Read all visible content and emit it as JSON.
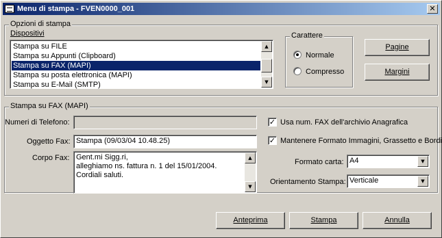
{
  "window": {
    "title": "Menu di stampa - FVEN0000_001",
    "close_glyph": "✕"
  },
  "options": {
    "title": "Opzioni di stampa",
    "devices_label": "Dispositivi",
    "devices": [
      "Stampa su FILE",
      "Stampa su Appunti (Clipboard)",
      "Stampa su FAX (MAPI)",
      "Stampa su posta elettronica (MAPI)",
      "Stampa su E-Mail (SMTP)"
    ],
    "selected_device_index": 2,
    "character": {
      "title": "Carattere",
      "normal_label": "Normale",
      "compressed_label": "Compresso",
      "selected": "Normale"
    },
    "pages_button": "Pagine",
    "margins_button": "Margini"
  },
  "fax": {
    "title": "Stampa su FAX (MAPI)",
    "phone_label": "Numeri di Telefono:",
    "phone_value": "",
    "subject_label": "Oggetto Fax:",
    "subject_value": "Stampa (09/03/04 10.48.25)",
    "body_label": "Corpo Fax:",
    "body_lines": [
      "Gent.mi Sigg.ri,",
      "alleghiamo ns. fattura n. 1 del 15/01/2004.",
      "Cordiali saluti."
    ],
    "use_fax_archive_label": "Usa num. FAX dell'archivio Anagrafica",
    "use_fax_archive_checked": true,
    "keep_format_label": "Mantenere Formato Immagini, Grassetto e Bordi",
    "keep_format_checked": true,
    "paper_format_label": "Formato carta:",
    "paper_format_value": "A4",
    "orientation_label": "Orientamento Stampa:",
    "orientation_value": "Verticale"
  },
  "footer": {
    "preview_button": "Anteprima",
    "print_button": "Stampa",
    "cancel_button": "Annulla"
  },
  "glyphs": {
    "up": "▲",
    "down": "▼",
    "check": "✓"
  }
}
